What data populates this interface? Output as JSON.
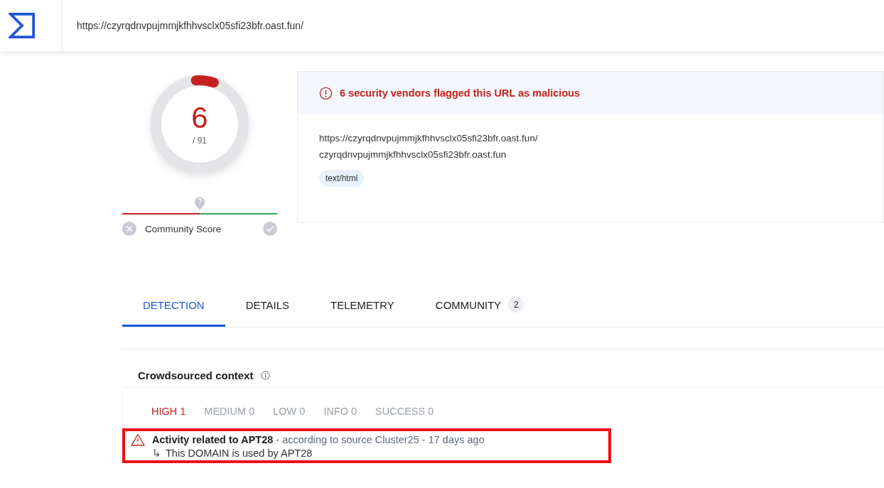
{
  "header": {
    "url": "https://czyrqdnvpujmmjkfhhvsclx05sfi23bfr.oast.fun/"
  },
  "score": {
    "value": "6",
    "total": "/ 91",
    "level": 0.066,
    "community_label": "Community Score"
  },
  "detection": {
    "banner": "6 security vendors flagged this URL as malicious",
    "url": "https://czyrqdnvpujmmjkfhhvsclx05sfi23bfr.oast.fun/",
    "domain": "czyrqdnvpujmmjkfhhvsclx05sfi23bfr.oast.fun",
    "tags": [
      "text/html"
    ]
  },
  "tabs": [
    {
      "label": "DETECTION",
      "selected": true
    },
    {
      "label": "DETAILS",
      "selected": false
    },
    {
      "label": "TELEMETRY",
      "selected": false
    },
    {
      "label": "COMMUNITY",
      "selected": false,
      "count": "2"
    }
  ],
  "crowdsourced": {
    "title": "Crowdsourced context",
    "severities": [
      {
        "label": "HIGH 1",
        "selected": true
      },
      {
        "label": "MEDIUM 0",
        "selected": false
      },
      {
        "label": "LOW 0",
        "selected": false
      },
      {
        "label": "INFO 0",
        "selected": false
      },
      {
        "label": "SUCCESS 0",
        "selected": false
      }
    ],
    "alert": {
      "title": "**Activity related to APT28** - according to source Cluster25 - 17 days ago",
      "arrow": "↳",
      "detail": "This DOMAIN is used by APT28"
    }
  }
}
